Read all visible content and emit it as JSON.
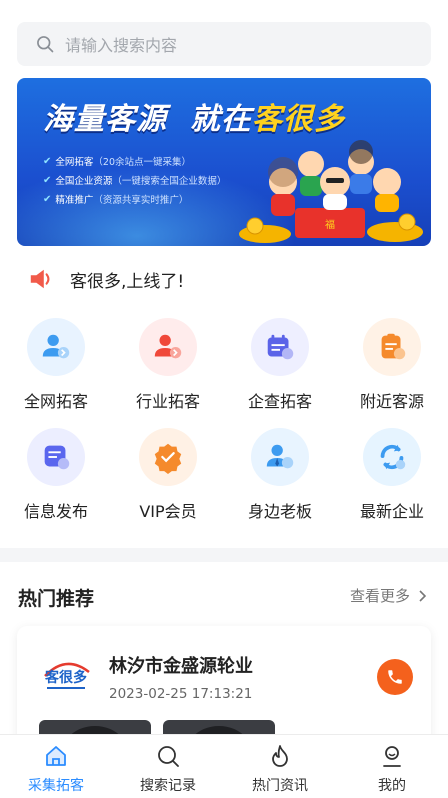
{
  "search": {
    "placeholder": "请输入搜索内容"
  },
  "banner": {
    "title_part1": "海量客源",
    "title_part2": "就在",
    "title_highlight": "客很多",
    "features": [
      {
        "label": "全网拓客",
        "detail": "（20余站点一键采集）"
      },
      {
        "label": "全国企业资源",
        "detail": "（一键搜索全国企业数据）"
      },
      {
        "label": "精准推广",
        "detail": "（资源共享实时推广）"
      }
    ]
  },
  "notice": {
    "text": "客很多,上线了!"
  },
  "grid": {
    "items": [
      {
        "label": "全网拓客",
        "icon": "user-share-icon",
        "bg": "#e8f3ff"
      },
      {
        "label": "行业拓客",
        "icon": "user-arrow-icon",
        "bg": "#ffecec"
      },
      {
        "label": "企查拓客",
        "icon": "calendar-icon",
        "bg": "#eeefff"
      },
      {
        "label": "附近客源",
        "icon": "clipboard-search-icon",
        "bg": "#fff2e6"
      },
      {
        "label": "信息发布",
        "icon": "edit-doc-icon",
        "bg": "#eceeff"
      },
      {
        "label": "VIP会员",
        "icon": "vip-badge-icon",
        "bg": "#fff1e5"
      },
      {
        "label": "身边老板",
        "icon": "boss-search-icon",
        "bg": "#e8f4ff"
      },
      {
        "label": "最新企业",
        "icon": "refresh-icon",
        "bg": "#e6f4ff"
      }
    ]
  },
  "section": {
    "title": "热门推荐",
    "more": "查看更多"
  },
  "card": {
    "logo_text": "客很多",
    "company": "林汐市金盛源轮业",
    "date": "2023-02-25 17:13:21"
  },
  "tabbar": {
    "tabs": [
      {
        "label": "采集拓客",
        "icon": "home-icon",
        "active": true
      },
      {
        "label": "搜索记录",
        "icon": "search-icon",
        "active": false
      },
      {
        "label": "热门资讯",
        "icon": "fire-icon",
        "active": false
      },
      {
        "label": "我的",
        "icon": "profile-icon",
        "active": false
      }
    ]
  },
  "colors": {
    "accent": "#2b8cff",
    "phone": "#f4611d",
    "banner": "#1b4fcf",
    "highlight": "#ffd21f"
  }
}
